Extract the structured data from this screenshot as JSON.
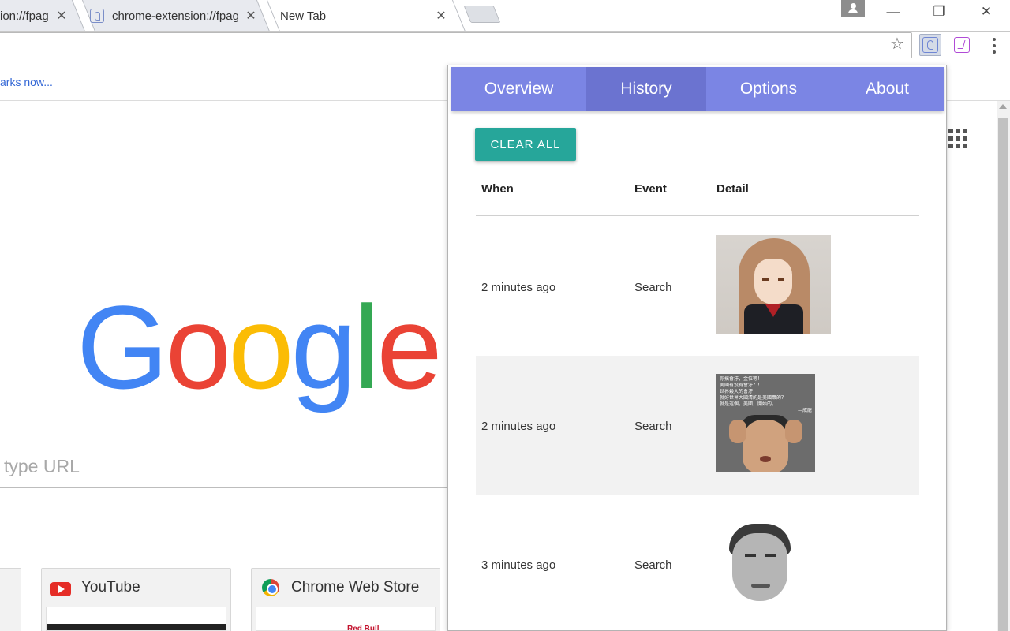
{
  "browser": {
    "tabs": [
      {
        "title": "ion://fpag",
        "close": "✕"
      },
      {
        "title": "chrome-extension://fpag",
        "close": "✕"
      },
      {
        "title": "New Tab",
        "close": "✕"
      }
    ],
    "window_controls": {
      "minimize": "—",
      "restore": "❐",
      "close": "✕"
    },
    "star_icon": "☆"
  },
  "page": {
    "bookmarks_link": "arks now...",
    "logo_letters": [
      "G",
      "o",
      "o",
      "g",
      "l",
      "e"
    ],
    "logo_colors": [
      "#4285f4",
      "#ea4335",
      "#fbbc05",
      "#4285f4",
      "#34a853",
      "#ea4335"
    ],
    "search_placeholder": "type URL",
    "tiles": [
      {
        "title": "YouTube",
        "icon": "youtube-icon"
      },
      {
        "title": "Chrome Web Store",
        "icon": "chrome-web-store-icon",
        "thumb_text": "Red Bull"
      }
    ]
  },
  "popup": {
    "nav": [
      {
        "label": "Overview",
        "active": false
      },
      {
        "label": "History",
        "active": true
      },
      {
        "label": "Options",
        "active": false
      },
      {
        "label": "About",
        "active": false
      }
    ],
    "clear_button": "CLEAR ALL",
    "columns": {
      "when": "When",
      "event": "Event",
      "detail": "Detail"
    },
    "rows": [
      {
        "when": "2 minutes ago",
        "event": "Search",
        "detail_image": "anime-girl-image"
      },
      {
        "when": "2 minutes ago",
        "event": "Search",
        "detail_image": "jackie-chan-meme-image",
        "meme_text": [
          "你搞會汙，金位等！",
          "美國有沒有會汙？！",
          "世界最大的會汙！",
          "就好世界大國清的是美國衆的？",
          "就是這個，美國，開始的。",
          "—成龍"
        ]
      },
      {
        "when": "3 minutes ago",
        "event": "Search",
        "detail_image": "kappa-face-image"
      }
    ]
  }
}
